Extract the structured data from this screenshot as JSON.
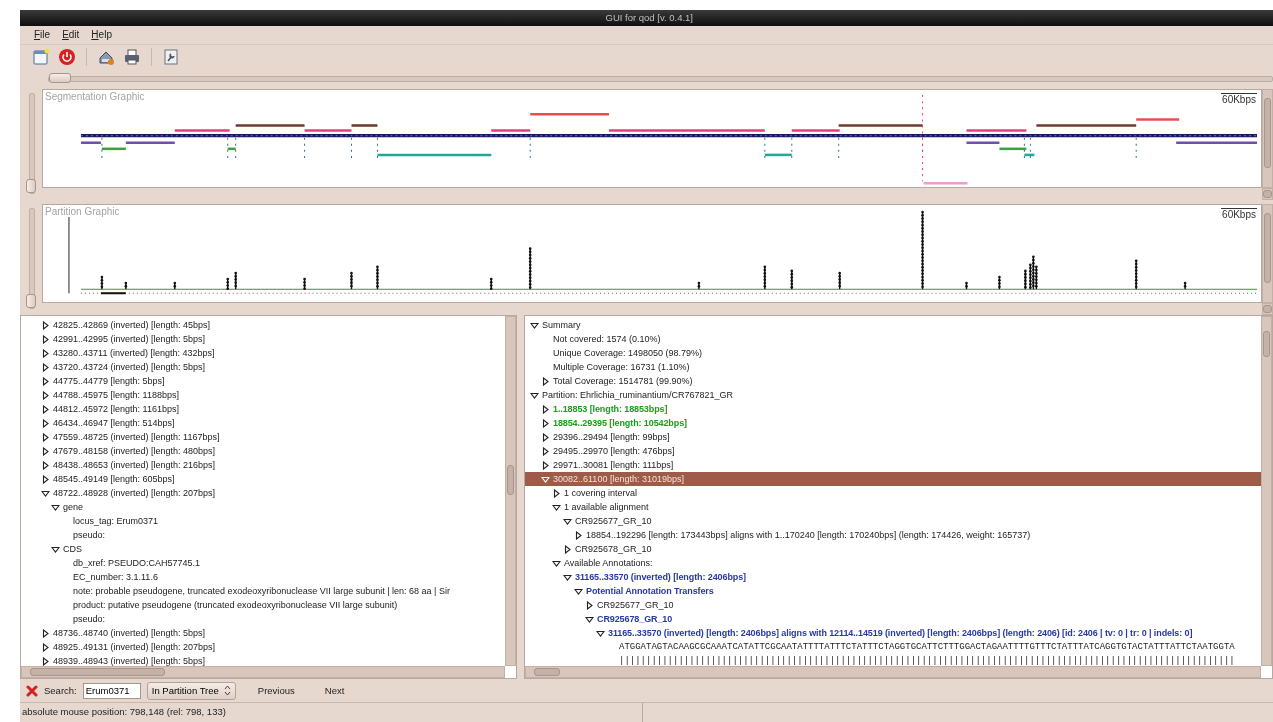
{
  "window": {
    "title": "GUI for qod [v. 0.4.1]"
  },
  "menu": [
    "File",
    "Edit",
    "Help"
  ],
  "zoom_slider": {
    "level": 0
  },
  "segmentation_graphic": {
    "title": "Segmentation Graphic",
    "scale": "60Kbps",
    "slider": {
      "level": 0
    }
  },
  "partition_graphic": {
    "title": "Partition Graphic",
    "scale": "60Kbps",
    "slider": {
      "level": 0
    }
  },
  "feature_tree": {
    "items": [
      {
        "text": "42825..42869 (inverted) [length: 45bps]",
        "expanded": false,
        "selected": false
      },
      {
        "text": "42991..42995 (inverted) [length: 5bps]",
        "expanded": false,
        "selected": false
      },
      {
        "text": "43280..43711 (inverted) [length: 432bps]",
        "expanded": false,
        "selected": false
      },
      {
        "text": "43720..43724 (inverted) [length: 5bps]",
        "expanded": false,
        "selected": false
      },
      {
        "text": "44775..44779 [length: 5bps]",
        "expanded": false,
        "selected": false
      },
      {
        "text": "44788..45975 [length: 1188bps]",
        "expanded": false,
        "selected": false
      },
      {
        "text": "44812..45972 [length: 1161bps]",
        "expanded": false,
        "selected": false
      },
      {
        "text": "46434..46947 [length: 514bps]",
        "expanded": false,
        "selected": false
      },
      {
        "text": "47559..48725 (inverted) [length: 1167bps]",
        "expanded": false,
        "selected": false
      },
      {
        "text": "47679..48158 (inverted) [length: 480bps]",
        "expanded": false,
        "selected": false
      },
      {
        "text": "48438..48653 (inverted) [length: 216bps]",
        "expanded": false,
        "selected": false
      },
      {
        "text": "48545..49149 [length: 605bps]",
        "expanded": false,
        "selected": false
      },
      {
        "text": "48722..48928 (inverted) [length: 207bps]",
        "expanded": true,
        "selected": false,
        "children": [
          {
            "text": "gene",
            "expanded": true,
            "selected": false,
            "children": [
              {
                "text": "locus_tag: Erum0371",
                "selected": false
              },
              {
                "text": "pseudo:",
                "selected": false
              }
            ]
          },
          {
            "text": "CDS",
            "expanded": true,
            "selected": false,
            "children": [
              {
                "text": "db_xref: PSEUDO:CAH57745.1",
                "selected": false
              },
              {
                "text": "EC_number: 3.1.11.6",
                "selected": false
              },
              {
                "text": "note: probable pseudogene, truncated exodeoxyribonuclease VII large subunit | len: 68 aa | Sir",
                "selected": false
              },
              {
                "text": "product: putative pseudogene (truncated exodeoxyribonuclease VII large subunit)",
                "selected": false
              },
              {
                "text": "pseudo:",
                "selected": false
              }
            ]
          }
        ]
      },
      {
        "text": "48736..48740 (inverted) [length: 5bps]",
        "expanded": false,
        "selected": false
      },
      {
        "text": "48925..49131 (inverted) [length: 207bps]",
        "expanded": false,
        "selected": false
      },
      {
        "text": "48939..48943 (inverted) [length: 5bps]",
        "expanded": false,
        "selected": false
      }
    ]
  },
  "partition_tree": {
    "items": [
      {
        "text": "Summary",
        "expanded": true,
        "selected": false,
        "children": [
          {
            "text": "Not covered: 1574 (0.10%)",
            "selected": false
          },
          {
            "text": "Unique Coverage: 1498050 (98.79%)",
            "selected": false
          },
          {
            "text": "Multiple Coverage: 16731 (1.10%)",
            "selected": false
          },
          {
            "text": "Total Coverage: 1514781 (99.90%)",
            "expanded": false,
            "selected": false
          }
        ]
      },
      {
        "text": "Partition: Ehrlichia_ruminantium/CR767821_GR",
        "expanded": true,
        "selected": false,
        "children": [
          {
            "text": "1..18853 [length: 18853bps]",
            "expanded": false,
            "selected": false,
            "color": "#18a018"
          },
          {
            "text": "18854..29395 [length: 10542bps]",
            "expanded": false,
            "selected": false,
            "color": "#18a018"
          },
          {
            "text": "29396..29494 [length: 99bps]",
            "expanded": false,
            "selected": false
          },
          {
            "text": "29495..29970 [length: 476bps]",
            "expanded": false,
            "selected": false
          },
          {
            "text": "29971..30081 [length: 111bps]",
            "expanded": false,
            "selected": false
          },
          {
            "text": "30082..61100 [length: 31019bps]",
            "expanded": true,
            "selected": true,
            "children": [
              {
                "text": "1 covering interval",
                "expanded": false,
                "selected": false
              },
              {
                "text": "1 available alignment",
                "expanded": true,
                "selected": false,
                "children": [
                  {
                    "text": "CR925677_GR_10",
                    "expanded": true,
                    "selected": false,
                    "children": [
                      {
                        "text": "18854..192296 [length: 173443bps] aligns with 1..170240 [length: 170240bps] (length: 174426, weight: 165737)",
                        "expanded": false,
                        "selected": false
                      }
                    ]
                  },
                  {
                    "text": "CR925678_GR_10",
                    "expanded": false,
                    "selected": false
                  }
                ]
              },
              {
                "text": "Available Annotations:",
                "expanded": true,
                "selected": false,
                "children": [
                  {
                    "text": "31165..33570 (inverted) [length: 2406bps]",
                    "expanded": true,
                    "selected": false,
                    "color": "#2838a8",
                    "children": [
                      {
                        "text": "Potential Annotation Transfers",
                        "expanded": true,
                        "selected": false,
                        "color": "#2838a8",
                        "children": [
                          {
                            "text": "CR925677_GR_10",
                            "expanded": false,
                            "selected": false
                          },
                          {
                            "text": "CR925678_GR_10",
                            "expanded": true,
                            "selected": false,
                            "color": "#2838a8",
                            "children": [
                              {
                                "text": "31165..33570 (inverted) [length: 2406bps] aligns with 12114..14519 (inverted) [length: 2406bps] (length: 2406) [id: 2406 | tv: 0 | tr: 0 | indels: 0]",
                                "expanded": true,
                                "selected": false,
                                "color": "#2838a8",
                                "children": [
                                  {
                                    "text": "ATGGATAGTACAAGCGCAAATCATATTCGCAATATTTTATTTCTATTTCTAGGTGCATTCTTTGGACTAGAATTTTGTTTCTATTTATCAGGTGTACTATTTATTCTAATGGTA",
                                    "kind": "sequence",
                                    "selected": false
                                  },
                                  {
                                    "text": "||||||||||||||||||||||||||||||||||||||||||||||||||||||||||||||||||||||||||||||||||||||||||||||||||||||||||||||||||",
                                    "kind": "sequence",
                                    "selected": false
                                  }
                                ]
                              }
                            ]
                          }
                        ]
                      }
                    ]
                  }
                ]
              }
            ]
          }
        ]
      }
    ]
  },
  "search_bar": {
    "label": "Search:",
    "value": "Erum0371",
    "scope": "In Partition Tree",
    "buttons": [
      "Previous",
      "Next"
    ]
  },
  "status_bar": {
    "text": "absolute mouse position: 798,148 (rel: 798, 133)"
  }
}
